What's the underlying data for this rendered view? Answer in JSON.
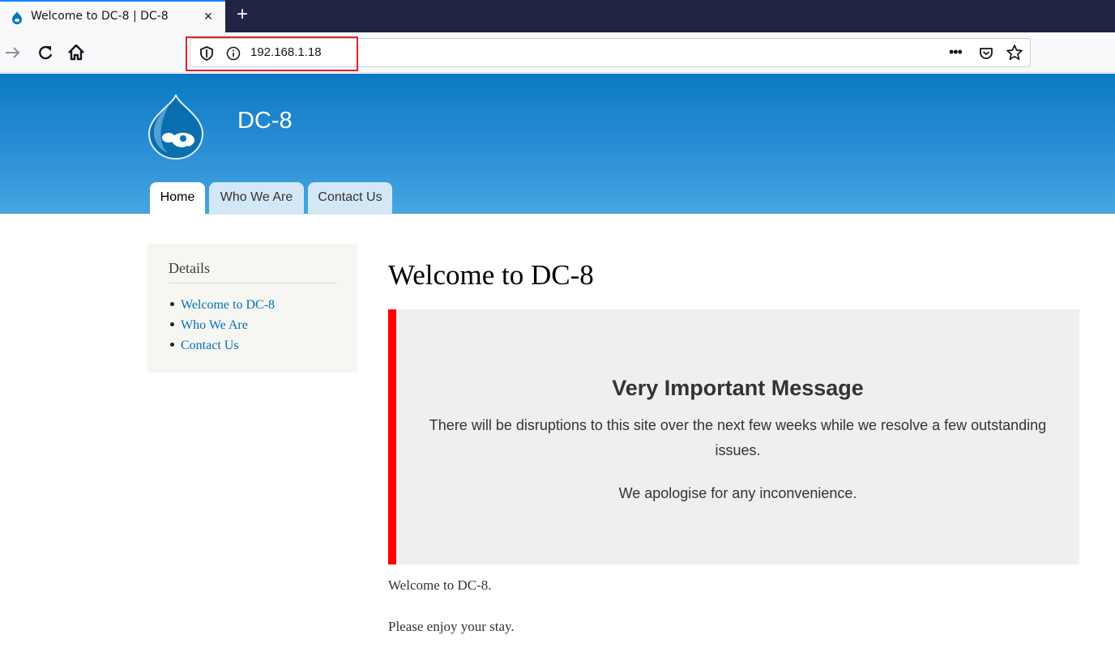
{
  "browser": {
    "tab_title": "Welcome to DC-8 | DC-8",
    "tab_close": "×",
    "new_tab": "+",
    "url": "192.168.1.18",
    "url_more": "•••",
    "accent_color": "#0a84ff",
    "highlight_color": "#e0212b"
  },
  "site": {
    "name": "DC-8",
    "logo": "drupal-drop-logo",
    "header_color": "#0b79c2",
    "tabs": [
      {
        "label": "Home",
        "active": true
      },
      {
        "label": "Who We Are",
        "active": false
      },
      {
        "label": "Contact Us",
        "active": false
      }
    ]
  },
  "sidebar": {
    "title": "Details",
    "items": [
      {
        "label": "Welcome to DC-8"
      },
      {
        "label": "Who We Are"
      },
      {
        "label": "Contact Us"
      }
    ],
    "link_color": "#0071b3"
  },
  "main": {
    "title": "Welcome to DC-8",
    "message": {
      "heading": "Very Important Message",
      "line1": "There will be disruptions to this site over the next few weeks while we resolve a few outstanding issues.",
      "line2": "We apologise for any inconvenience.",
      "accent_color": "#ff0000"
    },
    "paragraphs": [
      "Welcome to DC-8.",
      "Please enjoy your stay."
    ]
  }
}
